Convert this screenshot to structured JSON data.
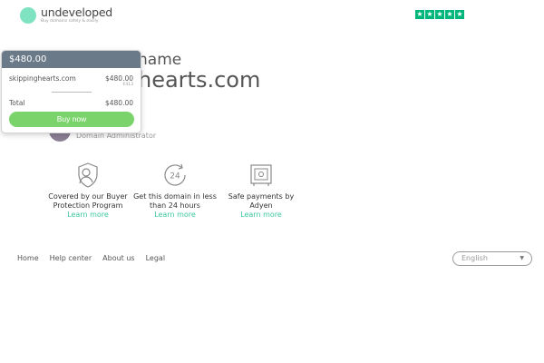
{
  "header": {
    "logo_word": "undeveloped",
    "logo_tagline": "Buy domains safely & easily",
    "rating_stars": 5,
    "rating_color": "#00b67a"
  },
  "hero": {
    "partial_title": "name",
    "partial_domain": "hearts.com"
  },
  "admin": {
    "label": "Domain Administrator"
  },
  "cart": {
    "header_price": "$480.00",
    "item_name": "skippinghearts.com",
    "item_price": "$480.00",
    "item_sub_price": "€413",
    "total_label": "Total",
    "total_value": "$480.00",
    "buy_label": "Buy  now",
    "buy_color": "#7bd36b",
    "header_color": "#6b7a89"
  },
  "features": [
    {
      "icon": "protection-user-icon",
      "title_line1": "Covered by our Buyer",
      "title_line2": "Protection Program",
      "link": "Learn more"
    },
    {
      "icon": "24-hour-clock-icon",
      "title_line1": "Get this domain in less",
      "title_line2": "than 24 hours",
      "link": "Learn more"
    },
    {
      "icon": "secure-vault-icon",
      "title_line1": "Safe payments by",
      "title_line2": "Adyen",
      "link": "Learn more"
    }
  ],
  "footer": {
    "links": [
      "Home",
      "Help center",
      "About us",
      "Legal"
    ],
    "language": "English"
  },
  "accent_color": "#3cc8a0"
}
